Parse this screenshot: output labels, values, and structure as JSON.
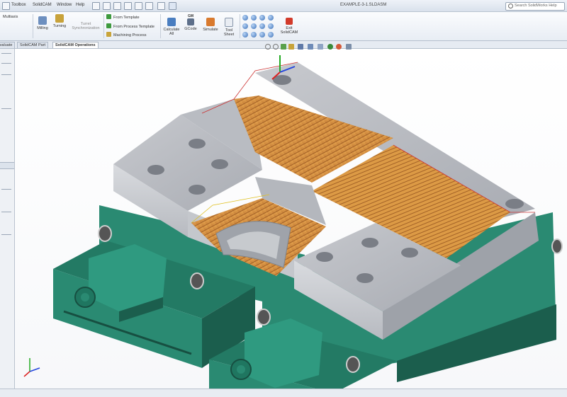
{
  "titlebar": {
    "menus": [
      "Toolbox",
      "SolidCAM",
      "Window",
      "Help"
    ],
    "document_title": "EXAMPLE-3-1.SLDASM",
    "search_placeholder": "Search SolidWorks Help"
  },
  "ribbon": {
    "multiaxis_label": "Multiaxis",
    "milling_label": "Milling",
    "turning_label": "Turning",
    "turret_label_1": "Turret",
    "turret_label_2": "Synchronization",
    "from_template_label": "From Template",
    "from_process_template_label": "From Process Template",
    "machining_process_label": "Machining Process",
    "calculate_label_1": "Calculate",
    "calculate_label_2": "All",
    "gcode_label": "GCode",
    "gcode_badge": "GM",
    "simulate_label": "Simulate",
    "tool_sheet_label_1": "Tool",
    "tool_sheet_label_2": "Sheet",
    "exit_label_1": "Exit",
    "exit_label_2": "SolidCAM"
  },
  "tabs": [
    "Evaluate",
    "SolidCAM Part",
    "SolidCAM Operations"
  ],
  "colors": {
    "fixture_green": "#2a8a72",
    "fixture_dark": "#1b5e4d",
    "part_grey": "#b3b6bd",
    "toolpath_orange": "#d88a2c",
    "accent_blue": "#3a6fb7"
  }
}
